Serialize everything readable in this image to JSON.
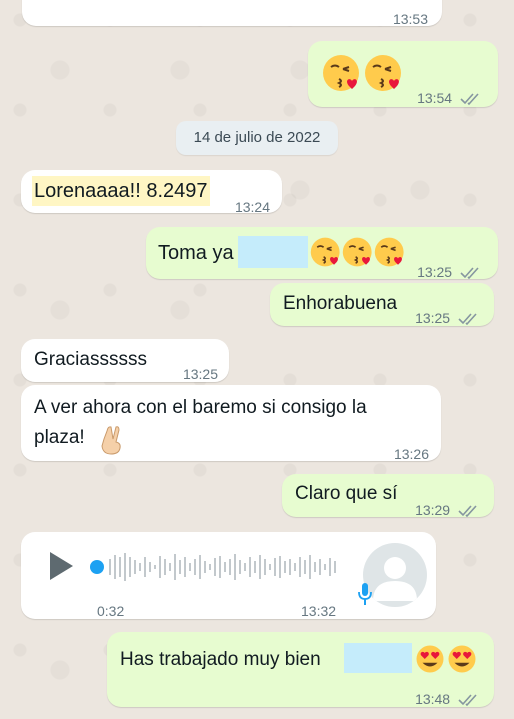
{
  "messages": {
    "m0": {
      "time": "13:53"
    },
    "m1": {
      "time": "13:54",
      "emoji": [
        "kiss-heart-emoji",
        "kiss-heart-emoji"
      ]
    },
    "date_separator": "14 de julio de 2022",
    "m2": {
      "text": "Lorenaaaa!! 8.2497",
      "time": "13:24"
    },
    "m3": {
      "text": "Toma ya",
      "time": "13:25",
      "emoji": [
        "kiss-heart-emoji",
        "kiss-heart-emoji",
        "kiss-heart-emoji"
      ]
    },
    "m4": {
      "text": "Enhorabuena",
      "time": "13:25"
    },
    "m5": {
      "text": "Graciassssss",
      "time": "13:25"
    },
    "m6": {
      "line1": "A ver ahora con el baremo si consigo la",
      "line2": "plaza!",
      "time": "13:26",
      "emoji": "crossed-fingers-emoji"
    },
    "m7": {
      "text": "Claro que sí",
      "time": "13:29"
    },
    "voice": {
      "duration": "0:32",
      "time": "13:32"
    },
    "m8": {
      "text": "Has trabajado muy bien",
      "time": "13:48",
      "emoji": [
        "heart-eyes-emoji",
        "heart-eyes-emoji"
      ]
    }
  },
  "colors": {
    "incoming_bubble": "#ffffff",
    "outgoing_bubble": "#e7fcd0",
    "read_ticks": "#8696a0",
    "accent_blue": "#1da1f2",
    "redaction": "#c5ecfb"
  }
}
